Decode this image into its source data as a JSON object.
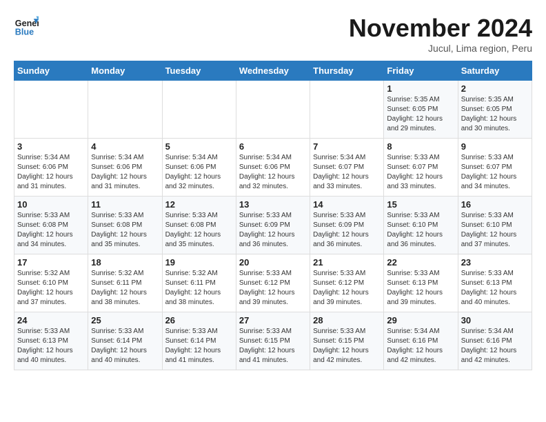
{
  "header": {
    "logo_text_1": "General",
    "logo_text_2": "Blue",
    "month_title": "November 2024",
    "subtitle": "Jucul, Lima region, Peru"
  },
  "days_of_week": [
    "Sunday",
    "Monday",
    "Tuesday",
    "Wednesday",
    "Thursday",
    "Friday",
    "Saturday"
  ],
  "weeks": [
    [
      {
        "day": "",
        "info": ""
      },
      {
        "day": "",
        "info": ""
      },
      {
        "day": "",
        "info": ""
      },
      {
        "day": "",
        "info": ""
      },
      {
        "day": "",
        "info": ""
      },
      {
        "day": "1",
        "info": "Sunrise: 5:35 AM\nSunset: 6:05 PM\nDaylight: 12 hours and 29 minutes."
      },
      {
        "day": "2",
        "info": "Sunrise: 5:35 AM\nSunset: 6:05 PM\nDaylight: 12 hours and 30 minutes."
      }
    ],
    [
      {
        "day": "3",
        "info": "Sunrise: 5:34 AM\nSunset: 6:06 PM\nDaylight: 12 hours and 31 minutes."
      },
      {
        "day": "4",
        "info": "Sunrise: 5:34 AM\nSunset: 6:06 PM\nDaylight: 12 hours and 31 minutes."
      },
      {
        "day": "5",
        "info": "Sunrise: 5:34 AM\nSunset: 6:06 PM\nDaylight: 12 hours and 32 minutes."
      },
      {
        "day": "6",
        "info": "Sunrise: 5:34 AM\nSunset: 6:06 PM\nDaylight: 12 hours and 32 minutes."
      },
      {
        "day": "7",
        "info": "Sunrise: 5:34 AM\nSunset: 6:07 PM\nDaylight: 12 hours and 33 minutes."
      },
      {
        "day": "8",
        "info": "Sunrise: 5:33 AM\nSunset: 6:07 PM\nDaylight: 12 hours and 33 minutes."
      },
      {
        "day": "9",
        "info": "Sunrise: 5:33 AM\nSunset: 6:07 PM\nDaylight: 12 hours and 34 minutes."
      }
    ],
    [
      {
        "day": "10",
        "info": "Sunrise: 5:33 AM\nSunset: 6:08 PM\nDaylight: 12 hours and 34 minutes."
      },
      {
        "day": "11",
        "info": "Sunrise: 5:33 AM\nSunset: 6:08 PM\nDaylight: 12 hours and 35 minutes."
      },
      {
        "day": "12",
        "info": "Sunrise: 5:33 AM\nSunset: 6:08 PM\nDaylight: 12 hours and 35 minutes."
      },
      {
        "day": "13",
        "info": "Sunrise: 5:33 AM\nSunset: 6:09 PM\nDaylight: 12 hours and 36 minutes."
      },
      {
        "day": "14",
        "info": "Sunrise: 5:33 AM\nSunset: 6:09 PM\nDaylight: 12 hours and 36 minutes."
      },
      {
        "day": "15",
        "info": "Sunrise: 5:33 AM\nSunset: 6:10 PM\nDaylight: 12 hours and 36 minutes."
      },
      {
        "day": "16",
        "info": "Sunrise: 5:33 AM\nSunset: 6:10 PM\nDaylight: 12 hours and 37 minutes."
      }
    ],
    [
      {
        "day": "17",
        "info": "Sunrise: 5:32 AM\nSunset: 6:10 PM\nDaylight: 12 hours and 37 minutes."
      },
      {
        "day": "18",
        "info": "Sunrise: 5:32 AM\nSunset: 6:11 PM\nDaylight: 12 hours and 38 minutes."
      },
      {
        "day": "19",
        "info": "Sunrise: 5:32 AM\nSunset: 6:11 PM\nDaylight: 12 hours and 38 minutes."
      },
      {
        "day": "20",
        "info": "Sunrise: 5:33 AM\nSunset: 6:12 PM\nDaylight: 12 hours and 39 minutes."
      },
      {
        "day": "21",
        "info": "Sunrise: 5:33 AM\nSunset: 6:12 PM\nDaylight: 12 hours and 39 minutes."
      },
      {
        "day": "22",
        "info": "Sunrise: 5:33 AM\nSunset: 6:13 PM\nDaylight: 12 hours and 39 minutes."
      },
      {
        "day": "23",
        "info": "Sunrise: 5:33 AM\nSunset: 6:13 PM\nDaylight: 12 hours and 40 minutes."
      }
    ],
    [
      {
        "day": "24",
        "info": "Sunrise: 5:33 AM\nSunset: 6:13 PM\nDaylight: 12 hours and 40 minutes."
      },
      {
        "day": "25",
        "info": "Sunrise: 5:33 AM\nSunset: 6:14 PM\nDaylight: 12 hours and 40 minutes."
      },
      {
        "day": "26",
        "info": "Sunrise: 5:33 AM\nSunset: 6:14 PM\nDaylight: 12 hours and 41 minutes."
      },
      {
        "day": "27",
        "info": "Sunrise: 5:33 AM\nSunset: 6:15 PM\nDaylight: 12 hours and 41 minutes."
      },
      {
        "day": "28",
        "info": "Sunrise: 5:33 AM\nSunset: 6:15 PM\nDaylight: 12 hours and 42 minutes."
      },
      {
        "day": "29",
        "info": "Sunrise: 5:34 AM\nSunset: 6:16 PM\nDaylight: 12 hours and 42 minutes."
      },
      {
        "day": "30",
        "info": "Sunrise: 5:34 AM\nSunset: 6:16 PM\nDaylight: 12 hours and 42 minutes."
      }
    ]
  ]
}
